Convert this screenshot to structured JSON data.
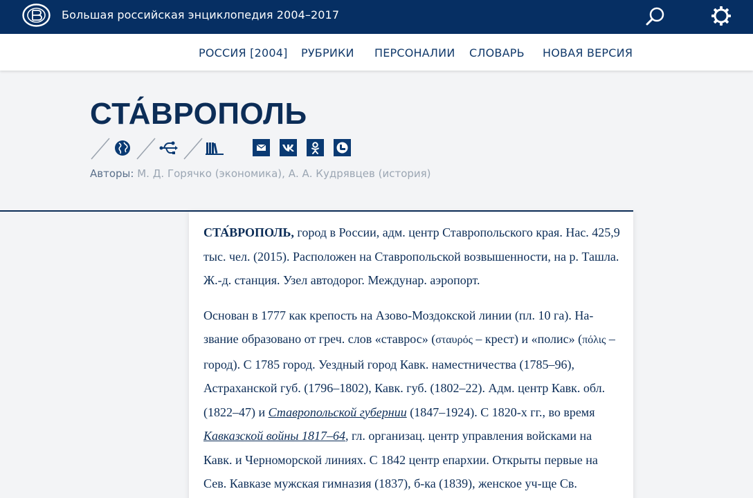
{
  "header": {
    "site_title": "Большая российская энциклопедия 2004–2017"
  },
  "nav": {
    "items": [
      {
        "label": "РОССИЯ [2004]"
      },
      {
        "label": "РУБРИКИ"
      },
      {
        "label": "ПЕРСОНАЛИИ"
      },
      {
        "label": "СЛОВАРЬ"
      },
      {
        "label": "НОВАЯ ВЕРСИЯ"
      }
    ]
  },
  "article": {
    "title": "СТА́ВРОПОЛЬ",
    "authors_label": "Авторы:",
    "authors": "М. Д. Горячко (экономика), А. А. Кудрявцев (история)",
    "p1": {
      "headword": "СТА́ВРОПОЛЬ,",
      "text": " город в России, адм. центр Ставропольского края. Нас. 425,9 тыс. чел. (2015). Расположен на Ставропольской возвышенности, на р. Ташла. Ж.-д. станция. Узел автодорог. Междунар. аэропорт."
    },
    "p2": {
      "t1": "Основан в 1777 как крепость на Азово-Моздокской линии (пл. 10 га). На­звание образовано от греч. слов «ставрос» (",
      "g1": "σταυρός",
      "t2": " – крест) и «полис» (",
      "g2": "πόλις",
      "t3": " – город). С 1785 город. Уездный город Кавк. наместничества (1785–96), Астраханской губ. (1796–1802), Кавк. губ. (1802–22). Адм. центр Кавк. обл. (1822–47) и ",
      "link1": "Ставропольской губернии",
      "t4": " (1847–1924). С 1820-х гг., во вре­мя ",
      "link2": "Кавказской войны 1817–64",
      "t5": ", гл. организац. центр управления войсками на Кавк. и Черноморской линиях. С 1842 центр епархии. Открыты первые на Сев. Кавказе мужская гимназия (1837), б-ка (1839), женское уч-ще Св."
    }
  },
  "icons": {
    "logo": "bre-logo-icon",
    "search": "search-icon",
    "settings": "gear-icon",
    "tools": [
      "globe-icon",
      "usb-tree-icon",
      "books-icon"
    ],
    "share": [
      "mail-icon",
      "vk-icon",
      "odnoklassniki-icon",
      "livejournal-icon"
    ]
  },
  "colors": {
    "header_bg": "#062f63",
    "accent": "#0a3a73",
    "text": "#0c2d57",
    "page_bg": "#f3f4f6"
  }
}
